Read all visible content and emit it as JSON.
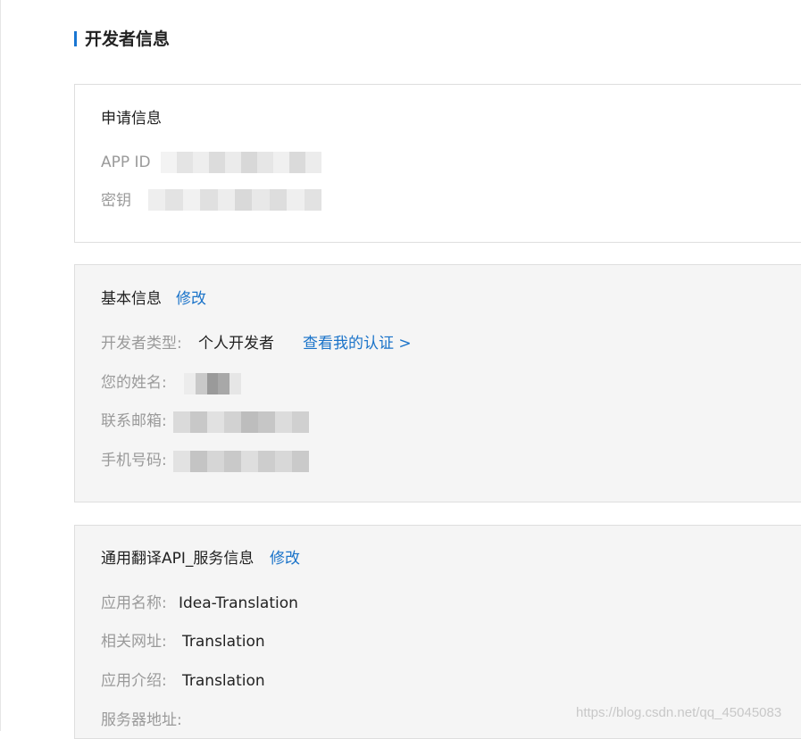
{
  "page": {
    "title": "开发者信息"
  },
  "apply_info": {
    "title": "申请信息",
    "app_id_label": "APP ID",
    "secret_label": "密钥"
  },
  "basic_info": {
    "title": "基本信息",
    "edit_label": "修改",
    "dev_type_label": "开发者类型:",
    "dev_type_value": "个人开发者",
    "view_cert_link": "查看我的认证 >",
    "name_label": "您的姓名:",
    "email_label": "联系邮箱:",
    "phone_label": "手机号码:"
  },
  "service_info": {
    "title": "通用翻译API_服务信息",
    "edit_label": "修改",
    "app_name_label": "应用名称:",
    "app_name_value": "Idea-Translation",
    "site_label": "相关网址:",
    "site_value": "Translation",
    "intro_label": "应用介绍:",
    "intro_value": "Translation",
    "server_label": "服务器地址:"
  },
  "watermark": "https://blog.csdn.net/qq_45045083",
  "colors": {
    "accent": "#1976d2",
    "link": "#1a73c9",
    "label": "#9a9a9a"
  }
}
